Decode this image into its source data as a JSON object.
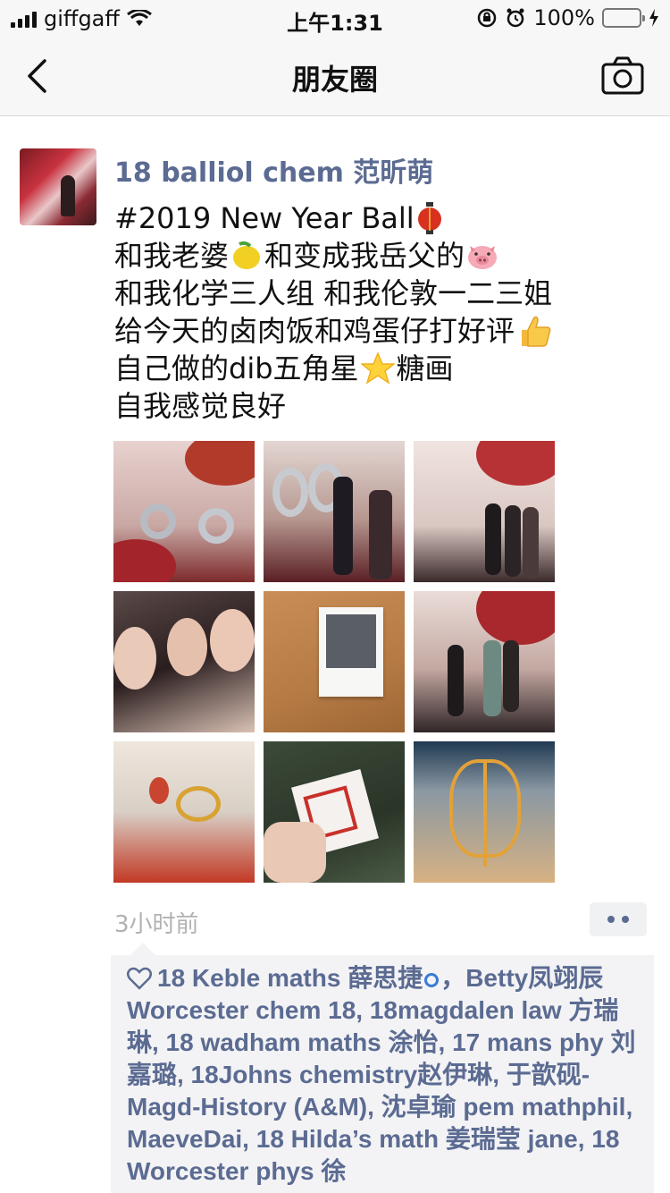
{
  "status_bar": {
    "carrier": "giffgaff",
    "time": "上午1:31",
    "battery_percent": "100%",
    "battery_level": 1.0
  },
  "nav": {
    "title": "朋友圈",
    "back_icon": "chevron-left-icon",
    "camera_icon": "camera-icon"
  },
  "post": {
    "author": "18 balliol chem 范昕萌",
    "lines": [
      "#2019 New Year Ball",
      "和我老婆",
      "和变成我岳父的",
      "和我化学三人组 和我伦敦一二三姐",
      "给今天的卤肉饭和鸡蛋仔打好评",
      "自己做的dib五角星",
      "糖画",
      "自我感觉良好"
    ],
    "timestamp": "3小时前",
    "likes": {
      "names_part1": "18 Keble maths 薛思捷",
      "names_part2": "，Betty凤翊辰 Worcester chem 18, 18magdalen law 方瑞琳, 18 wadham maths 涂怡, 17 mans phy 刘嘉璐, 18Johns chemistry赵伊琳, 于歆砚-Magd-History (A&M), 沈卓瑜 pem mathphil, MaeveDai, 18 Hilda’s math 姜瑞莹 jane, 18 Worcester phys 徐"
    }
  },
  "colors": {
    "link": "#5b6b92",
    "timestamp": "#b2b2b2",
    "battery": "#4cd964"
  }
}
